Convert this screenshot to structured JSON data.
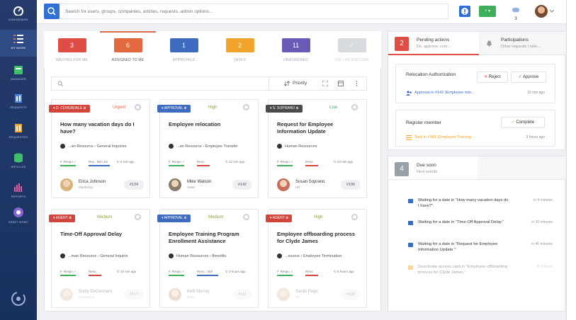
{
  "sidebar": {
    "items": [
      {
        "label": "DASHBOARD"
      },
      {
        "label": "MY WORK"
      },
      {
        "label": "MANAGER"
      },
      {
        "label": "REQUESTS"
      },
      {
        "label": "REQUESTED"
      },
      {
        "label": "ARTICLES"
      },
      {
        "label": "REPORTS"
      },
      {
        "label": "ASSET MGMT"
      }
    ]
  },
  "search": {
    "placeholder": "Search for users, groups, companies, articles, requests, admin options..."
  },
  "topbar": {
    "new_label": "+ ▾",
    "notification_count": "3"
  },
  "tabs": [
    {
      "count": "3",
      "label": "WAITING FOR ME",
      "color": "#e04d45"
    },
    {
      "count": "6",
      "label": "ASSIGNED TO ME",
      "color": "#e2683f"
    },
    {
      "count": "1",
      "label": "APPROVALS",
      "color": "#3d6bbf"
    },
    {
      "count": "2",
      "label": "TASKS",
      "color": "#f0a42a"
    },
    {
      "count": "11",
      "label": "UNASSIGNED",
      "color": "#6a5ab5"
    },
    {
      "count": "✓",
      "label": "COLLABORATIONS",
      "color": "#b8bcc4"
    }
  ],
  "toolbar": {
    "priority_label": "Priority"
  },
  "cards": [
    {
      "chip": "D. COVERDALE",
      "chip_color": "#d2453d",
      "priority": "Urgent",
      "priority_color": "#e2683f",
      "title": "How many vacation days do I have?",
      "path": "...an Resource › General Inquiries",
      "m1": "F. Respo",
      "m2": "Res.: 0Eh 3m",
      "time": "5 min ago",
      "name": "Erica Johnson",
      "dept": "Marketing",
      "id": "#134"
    },
    {
      "chip": "APPROVAL",
      "chip_color": "#3d6bbf",
      "priority": "High",
      "priority_color": "#8aa12a",
      "title": "Employee relocation",
      "path": "...an Resource › Employee Transfer",
      "m1": "F. Respo",
      "m2": "Reso.",
      "time": "12 min ago",
      "name": "Mike Watson",
      "dept": "Sales",
      "id": "#142"
    },
    {
      "chip": "S. SOPRANO",
      "chip_color": "#4a4a4a",
      "priority": "Low",
      "priority_color": "#3fae5a",
      "title": "Request for Employee Information Update",
      "path": "Human Resources",
      "m1": "F. Respo",
      "m2": "Reso.",
      "time": "23 min ago",
      "name": "Susan Soprano",
      "dept": "HR",
      "id": "#190"
    },
    {
      "chip": "AGENT",
      "chip_color": "#d2453d",
      "priority": "Medium",
      "priority_color": "#8aa12a",
      "title": "Time-Off Approval Delay",
      "path": "...man Resource › General Inquirie",
      "m1": "F. Respo",
      "m2": "Reso.",
      "time": "34 min ago",
      "name": "Emily DeGennaro",
      "dept": "Operations",
      "id": "#117"
    },
    {
      "chip": "APPROVAL",
      "chip_color": "#3d6bbf",
      "priority": "Medium",
      "priority_color": "#8aa12a",
      "title": "Employee Training Program Enrollment Assistance",
      "path": "Human Resources › Benefits",
      "m1": "F. Respo",
      "m2": "Reso.: 0Eh",
      "time": "3 hours ago",
      "name": "Kelli Murray",
      "dept": "Sales",
      "id": "#111"
    },
    {
      "chip": "AGENT",
      "chip_color": "#d2453d",
      "priority": "High",
      "priority_color": "#8aa12a",
      "title": "Employee offboarding process for Clyde James",
      "path": "...source › Employee Termination",
      "m1": "F. Respo",
      "m2": "Reso.",
      "time": "8 hours ago",
      "name": "Sarah Page",
      "dept": "HR",
      "id": "#136"
    }
  ],
  "pending": {
    "count": "2",
    "title": "Pending actions",
    "subtitle": "Do, approve, com...",
    "participations_title": "Participations",
    "participations_sub": "Other requests I take...",
    "items": [
      {
        "title": "Relocation Authorization",
        "meta": "Approval in #142 (Employee relo...",
        "time": "32 min ago",
        "btn1": "Reject",
        "btn2": "Approve"
      },
      {
        "title": "Register member",
        "meta": "Task in #181 (Employee Training...",
        "time": "3 hours ago",
        "btn1": "Complete"
      }
    ]
  },
  "due": {
    "count": "4",
    "title": "Due soon",
    "subtitle": "Next events",
    "items": [
      {
        "text": "Waiting for a date in \"How many vacation days do I have?\".",
        "time": "in 4 minutes"
      },
      {
        "text": "Waiting for a date in \"Time-Off Approval Delay.\"",
        "time": "in 30 minutes"
      },
      {
        "text": "Waiting for a date in \"Request for Employee Information Update.\"",
        "time": "in 46 minutes"
      },
      {
        "text": "Deactivate access card in \"Employee offboarding process for Clyde James.\"",
        "time": "in 3 hours"
      }
    ]
  }
}
